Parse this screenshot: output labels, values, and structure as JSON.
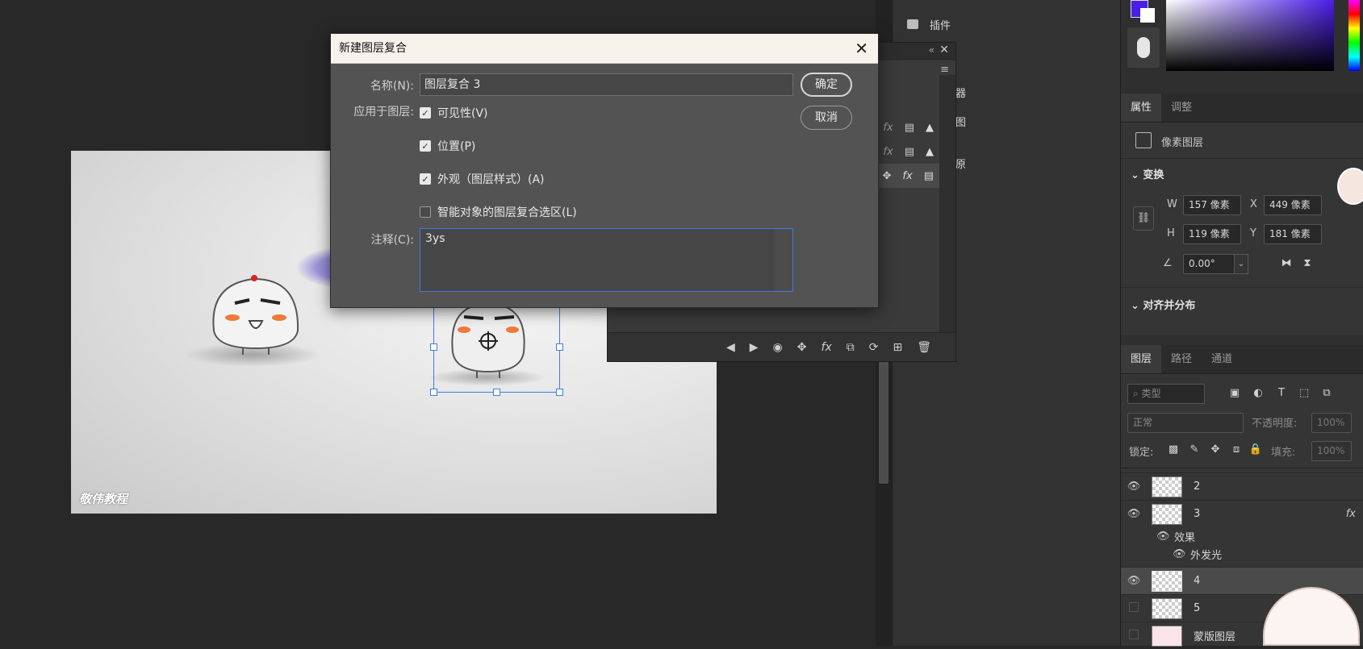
{
  "watermark": "敬伟教程",
  "mid_panel": {
    "items": [
      {
        "label": "插件"
      },
      {
        "label": "器"
      },
      {
        "label": "图"
      },
      {
        "label": "原"
      }
    ]
  },
  "color_picker": {
    "foreground": "#4a1ee8",
    "background": "#ffffff"
  },
  "properties": {
    "tabs": [
      {
        "label": "属性"
      },
      {
        "label": "调整"
      }
    ],
    "layer_type": "像素图层",
    "transform_header": "变换",
    "w_label": "W",
    "w_value": "157 像素",
    "h_label": "H",
    "h_value": "119 像素",
    "x_label": "X",
    "x_value": "449 像素",
    "y_label": "Y",
    "y_value": "181 像素",
    "angle_value": "0.00°",
    "align_header": "对齐并分布"
  },
  "layers": {
    "tabs": [
      {
        "label": "图层"
      },
      {
        "label": "路径"
      },
      {
        "label": "通道"
      }
    ],
    "filter_placeholder": "类型",
    "blend_mode": "正常",
    "opacity_label": "不透明度:",
    "opacity_value": "100%",
    "lock_label": "锁定:",
    "fill_label": "填充:",
    "fill_value": "100%",
    "rows": [
      {
        "name": "2",
        "fx": ""
      },
      {
        "name": "3",
        "fx": "fx"
      },
      {
        "name": "效果",
        "fx": ""
      },
      {
        "name": "外发光",
        "fx": ""
      },
      {
        "name": "4",
        "fx": ""
      },
      {
        "name": "5",
        "fx": ""
      },
      {
        "name": "蒙版图层",
        "fx": ""
      }
    ]
  },
  "dialog": {
    "title": "新建图层复合",
    "name_label": "名称(N):",
    "name_value": "图层复合 3",
    "apply_label": "应用于图层:",
    "options": [
      {
        "label": "可见性(V)",
        "checked": true
      },
      {
        "label": "位置(P)",
        "checked": true
      },
      {
        "label": "外观（图层样式）(A)",
        "checked": true
      },
      {
        "label": "智能对象的图层复合选区(L)",
        "checked": false
      }
    ],
    "comment_label": "注释(C):",
    "comment_value": "3ys",
    "ok_label": "确定",
    "cancel_label": "取消"
  }
}
